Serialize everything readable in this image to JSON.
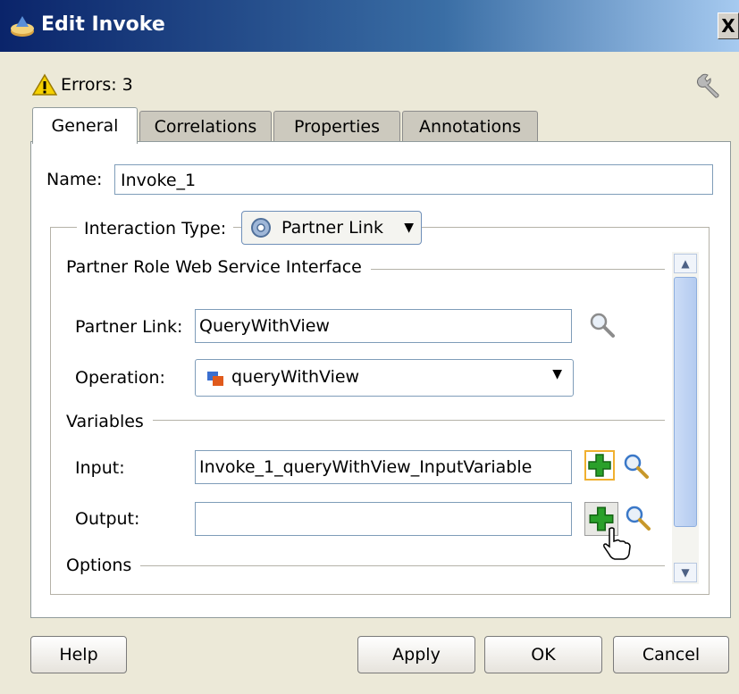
{
  "window": {
    "title": "Edit Invoke",
    "close_glyph": "X"
  },
  "status": {
    "errors_label": "Errors: 3",
    "warning_icon": "warning-icon"
  },
  "tabs": [
    {
      "label": "General",
      "active": true
    },
    {
      "label": "Correlations",
      "active": false
    },
    {
      "label": "Properties",
      "active": false
    },
    {
      "label": "Annotations",
      "active": false
    }
  ],
  "form": {
    "name_label": "Name:",
    "name_value": "Invoke_1",
    "interaction_type_label": "Interaction Type:",
    "interaction_type_value": "Partner Link",
    "partner_role_section": "Partner Role Web Service Interface",
    "partner_link_label": "Partner Link:",
    "partner_link_value": "QueryWithView",
    "operation_label": "Operation:",
    "operation_value": "queryWithView",
    "variables_section": "Variables",
    "input_label": "Input:",
    "input_value": "Invoke_1_queryWithView_InputVariable",
    "output_label": "Output:",
    "output_value": "",
    "options_section": "Options"
  },
  "buttons": {
    "help": "Help",
    "apply": "Apply",
    "ok": "OK",
    "cancel": "Cancel"
  },
  "colors": {
    "title_bar": "#0a246a",
    "dialog_bg": "#ece9d8",
    "add_icon_green": "#2aa02a",
    "warning_yellow": "#f5d000"
  }
}
